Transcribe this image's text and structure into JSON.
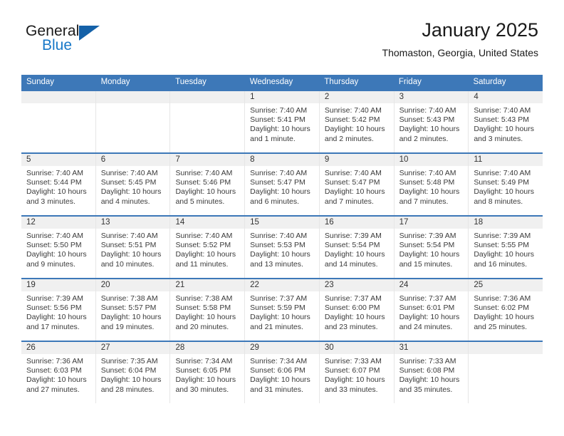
{
  "brand": {
    "name_part1": "General",
    "name_part2": "Blue",
    "triangle_color": "#1461a8",
    "blue_color": "#1878c8"
  },
  "header": {
    "title": "January 2025",
    "location": "Thomaston, Georgia, United States"
  },
  "theme": {
    "header_blue": "#3d78b8",
    "date_band_gray": "#f0f0f0",
    "text_color": "#333333"
  },
  "weekdays": [
    "Sunday",
    "Monday",
    "Tuesday",
    "Wednesday",
    "Thursday",
    "Friday",
    "Saturday"
  ],
  "weeks": [
    [
      {
        "date": "",
        "sunrise": "",
        "sunset": "",
        "daylight_line1": "",
        "daylight_line2": ""
      },
      {
        "date": "",
        "sunrise": "",
        "sunset": "",
        "daylight_line1": "",
        "daylight_line2": ""
      },
      {
        "date": "",
        "sunrise": "",
        "sunset": "",
        "daylight_line1": "",
        "daylight_line2": ""
      },
      {
        "date": "1",
        "sunrise": "Sunrise: 7:40 AM",
        "sunset": "Sunset: 5:41 PM",
        "daylight_line1": "Daylight: 10 hours",
        "daylight_line2": "and 1 minute."
      },
      {
        "date": "2",
        "sunrise": "Sunrise: 7:40 AM",
        "sunset": "Sunset: 5:42 PM",
        "daylight_line1": "Daylight: 10 hours",
        "daylight_line2": "and 2 minutes."
      },
      {
        "date": "3",
        "sunrise": "Sunrise: 7:40 AM",
        "sunset": "Sunset: 5:43 PM",
        "daylight_line1": "Daylight: 10 hours",
        "daylight_line2": "and 2 minutes."
      },
      {
        "date": "4",
        "sunrise": "Sunrise: 7:40 AM",
        "sunset": "Sunset: 5:43 PM",
        "daylight_line1": "Daylight: 10 hours",
        "daylight_line2": "and 3 minutes."
      }
    ],
    [
      {
        "date": "5",
        "sunrise": "Sunrise: 7:40 AM",
        "sunset": "Sunset: 5:44 PM",
        "daylight_line1": "Daylight: 10 hours",
        "daylight_line2": "and 3 minutes."
      },
      {
        "date": "6",
        "sunrise": "Sunrise: 7:40 AM",
        "sunset": "Sunset: 5:45 PM",
        "daylight_line1": "Daylight: 10 hours",
        "daylight_line2": "and 4 minutes."
      },
      {
        "date": "7",
        "sunrise": "Sunrise: 7:40 AM",
        "sunset": "Sunset: 5:46 PM",
        "daylight_line1": "Daylight: 10 hours",
        "daylight_line2": "and 5 minutes."
      },
      {
        "date": "8",
        "sunrise": "Sunrise: 7:40 AM",
        "sunset": "Sunset: 5:47 PM",
        "daylight_line1": "Daylight: 10 hours",
        "daylight_line2": "and 6 minutes."
      },
      {
        "date": "9",
        "sunrise": "Sunrise: 7:40 AM",
        "sunset": "Sunset: 5:47 PM",
        "daylight_line1": "Daylight: 10 hours",
        "daylight_line2": "and 7 minutes."
      },
      {
        "date": "10",
        "sunrise": "Sunrise: 7:40 AM",
        "sunset": "Sunset: 5:48 PM",
        "daylight_line1": "Daylight: 10 hours",
        "daylight_line2": "and 7 minutes."
      },
      {
        "date": "11",
        "sunrise": "Sunrise: 7:40 AM",
        "sunset": "Sunset: 5:49 PM",
        "daylight_line1": "Daylight: 10 hours",
        "daylight_line2": "and 8 minutes."
      }
    ],
    [
      {
        "date": "12",
        "sunrise": "Sunrise: 7:40 AM",
        "sunset": "Sunset: 5:50 PM",
        "daylight_line1": "Daylight: 10 hours",
        "daylight_line2": "and 9 minutes."
      },
      {
        "date": "13",
        "sunrise": "Sunrise: 7:40 AM",
        "sunset": "Sunset: 5:51 PM",
        "daylight_line1": "Daylight: 10 hours",
        "daylight_line2": "and 10 minutes."
      },
      {
        "date": "14",
        "sunrise": "Sunrise: 7:40 AM",
        "sunset": "Sunset: 5:52 PM",
        "daylight_line1": "Daylight: 10 hours",
        "daylight_line2": "and 11 minutes."
      },
      {
        "date": "15",
        "sunrise": "Sunrise: 7:40 AM",
        "sunset": "Sunset: 5:53 PM",
        "daylight_line1": "Daylight: 10 hours",
        "daylight_line2": "and 13 minutes."
      },
      {
        "date": "16",
        "sunrise": "Sunrise: 7:39 AM",
        "sunset": "Sunset: 5:54 PM",
        "daylight_line1": "Daylight: 10 hours",
        "daylight_line2": "and 14 minutes."
      },
      {
        "date": "17",
        "sunrise": "Sunrise: 7:39 AM",
        "sunset": "Sunset: 5:54 PM",
        "daylight_line1": "Daylight: 10 hours",
        "daylight_line2": "and 15 minutes."
      },
      {
        "date": "18",
        "sunrise": "Sunrise: 7:39 AM",
        "sunset": "Sunset: 5:55 PM",
        "daylight_line1": "Daylight: 10 hours",
        "daylight_line2": "and 16 minutes."
      }
    ],
    [
      {
        "date": "19",
        "sunrise": "Sunrise: 7:39 AM",
        "sunset": "Sunset: 5:56 PM",
        "daylight_line1": "Daylight: 10 hours",
        "daylight_line2": "and 17 minutes."
      },
      {
        "date": "20",
        "sunrise": "Sunrise: 7:38 AM",
        "sunset": "Sunset: 5:57 PM",
        "daylight_line1": "Daylight: 10 hours",
        "daylight_line2": "and 19 minutes."
      },
      {
        "date": "21",
        "sunrise": "Sunrise: 7:38 AM",
        "sunset": "Sunset: 5:58 PM",
        "daylight_line1": "Daylight: 10 hours",
        "daylight_line2": "and 20 minutes."
      },
      {
        "date": "22",
        "sunrise": "Sunrise: 7:37 AM",
        "sunset": "Sunset: 5:59 PM",
        "daylight_line1": "Daylight: 10 hours",
        "daylight_line2": "and 21 minutes."
      },
      {
        "date": "23",
        "sunrise": "Sunrise: 7:37 AM",
        "sunset": "Sunset: 6:00 PM",
        "daylight_line1": "Daylight: 10 hours",
        "daylight_line2": "and 23 minutes."
      },
      {
        "date": "24",
        "sunrise": "Sunrise: 7:37 AM",
        "sunset": "Sunset: 6:01 PM",
        "daylight_line1": "Daylight: 10 hours",
        "daylight_line2": "and 24 minutes."
      },
      {
        "date": "25",
        "sunrise": "Sunrise: 7:36 AM",
        "sunset": "Sunset: 6:02 PM",
        "daylight_line1": "Daylight: 10 hours",
        "daylight_line2": "and 25 minutes."
      }
    ],
    [
      {
        "date": "26",
        "sunrise": "Sunrise: 7:36 AM",
        "sunset": "Sunset: 6:03 PM",
        "daylight_line1": "Daylight: 10 hours",
        "daylight_line2": "and 27 minutes."
      },
      {
        "date": "27",
        "sunrise": "Sunrise: 7:35 AM",
        "sunset": "Sunset: 6:04 PM",
        "daylight_line1": "Daylight: 10 hours",
        "daylight_line2": "and 28 minutes."
      },
      {
        "date": "28",
        "sunrise": "Sunrise: 7:34 AM",
        "sunset": "Sunset: 6:05 PM",
        "daylight_line1": "Daylight: 10 hours",
        "daylight_line2": "and 30 minutes."
      },
      {
        "date": "29",
        "sunrise": "Sunrise: 7:34 AM",
        "sunset": "Sunset: 6:06 PM",
        "daylight_line1": "Daylight: 10 hours",
        "daylight_line2": "and 31 minutes."
      },
      {
        "date": "30",
        "sunrise": "Sunrise: 7:33 AM",
        "sunset": "Sunset: 6:07 PM",
        "daylight_line1": "Daylight: 10 hours",
        "daylight_line2": "and 33 minutes."
      },
      {
        "date": "31",
        "sunrise": "Sunrise: 7:33 AM",
        "sunset": "Sunset: 6:08 PM",
        "daylight_line1": "Daylight: 10 hours",
        "daylight_line2": "and 35 minutes."
      },
      {
        "date": "",
        "sunrise": "",
        "sunset": "",
        "daylight_line1": "",
        "daylight_line2": ""
      }
    ]
  ]
}
